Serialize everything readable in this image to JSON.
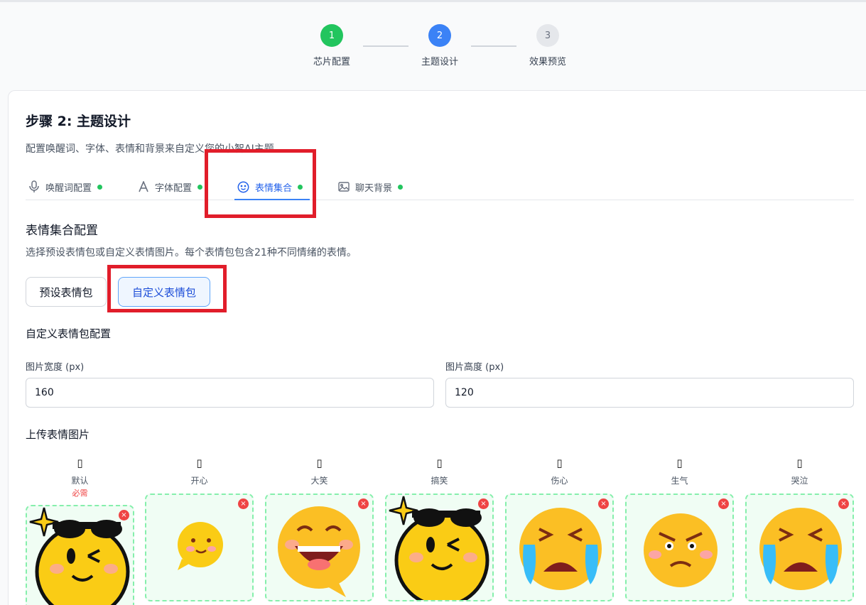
{
  "stepper": {
    "steps": [
      {
        "num": "1",
        "label": "芯片配置"
      },
      {
        "num": "2",
        "label": "主题设计"
      },
      {
        "num": "3",
        "label": "效果预览"
      }
    ]
  },
  "header": {
    "title": "步骤 2: 主题设计",
    "subtitle": "配置唤醒词、字体、表情和背景来自定义您的小智AI主题"
  },
  "tabs": [
    {
      "label": "唤醒词配置",
      "icon": "microphone-icon",
      "complete": true
    },
    {
      "label": "字体配置",
      "icon": "font-icon",
      "complete": true
    },
    {
      "label": "表情集合",
      "icon": "smiley-icon",
      "complete": true,
      "active": true
    },
    {
      "label": "聊天背景",
      "icon": "image-icon",
      "complete": true
    }
  ],
  "section": {
    "title": "表情集合配置",
    "description": "选择预设表情包或自定义表情图片。每个表情包包含21种不同情绪的表情。"
  },
  "mode_buttons": {
    "preset": "预设表情包",
    "custom": "自定义表情包",
    "selected": "custom"
  },
  "custom": {
    "title": "自定义表情包配置",
    "width_label": "图片宽度 (px)",
    "width_value": "160",
    "height_label": "图片高度 (px)",
    "height_value": "120",
    "upload_title": "上传表情图片"
  },
  "emotions": [
    {
      "glyph": "▯",
      "label": "默认",
      "required": "必需",
      "image": "cool-wink-emoji"
    },
    {
      "glyph": "▯",
      "label": "开心",
      "image": "small-happy-emoji"
    },
    {
      "glyph": "▯",
      "label": "大笑",
      "image": "laughing-emoji"
    },
    {
      "glyph": "▯",
      "label": "搞笑",
      "image": "cool-wink-emoji"
    },
    {
      "glyph": "▯",
      "label": "伤心",
      "image": "crying-emoji"
    },
    {
      "glyph": "▯",
      "label": "生气",
      "image": "angry-emoji"
    },
    {
      "glyph": "▯",
      "label": "哭泣",
      "image": "crying-emoji"
    }
  ],
  "delete_symbol": "×",
  "colors": {
    "accent": "#3b82f6",
    "success": "#22c55e",
    "danger": "#ef4444",
    "highlight": "#e11d2a"
  }
}
